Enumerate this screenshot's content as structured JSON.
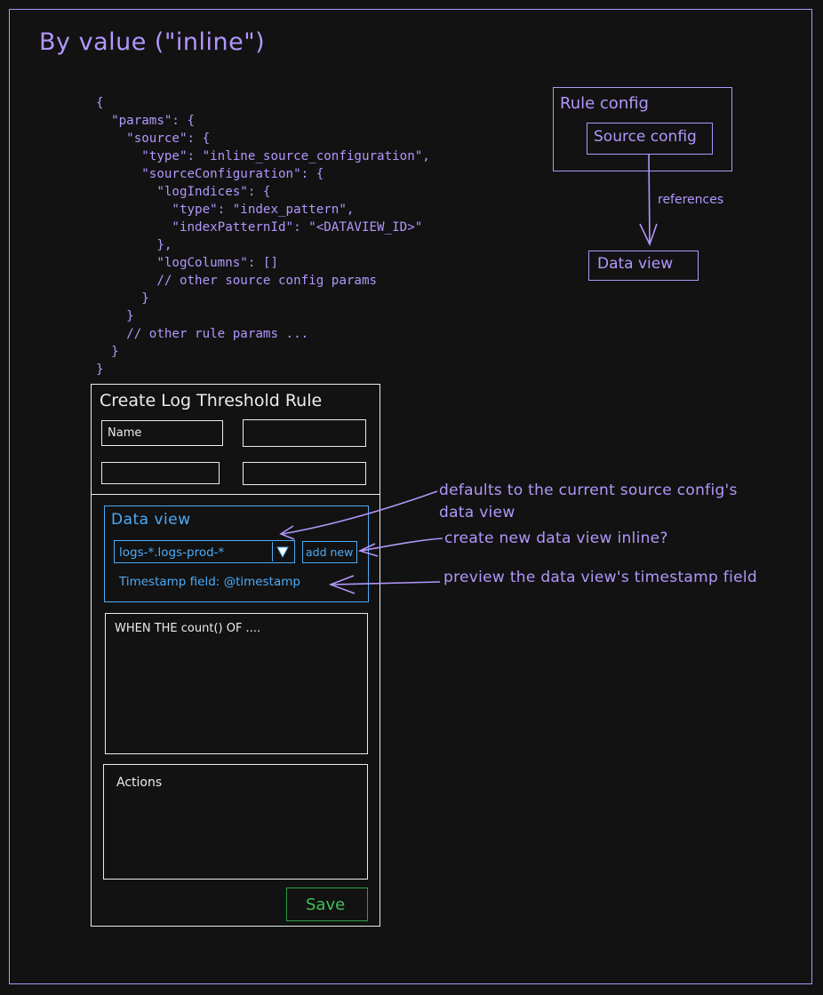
{
  "title": "By value (\"inline\")",
  "code_lines": [
    "{",
    "  \"params\": {",
    "    \"source\": {",
    "      \"type\": \"inline_source_configuration\",",
    "      \"sourceConfiguration\": {",
    "        \"logIndices\": {",
    "          \"type\": \"index_pattern\",",
    "          \"indexPatternId\": \"<DATAVIEW_ID>\"",
    "        },",
    "        \"logColumns\": []",
    "        // other source config params",
    "      }",
    "    }",
    "    // other rule params ...",
    "  }",
    "}"
  ],
  "diagram": {
    "rule_config": "Rule config",
    "source_config": "Source config",
    "references": "references",
    "data_view": "Data view"
  },
  "form": {
    "title": "Create Log Threshold Rule",
    "name_placeholder": "Name",
    "data_view_section": {
      "title": "Data view",
      "selected": "logs-*.logs-prod-*",
      "add_new": "add new",
      "timestamp": "Timestamp field: @timestamp"
    },
    "condition": "WHEN THE count() OF ....",
    "actions": "Actions",
    "save": "Save"
  },
  "annotations": {
    "defaults_line1": "defaults to the current source config's",
    "defaults_line2": "data view",
    "create_new": "create new data view inline?",
    "preview": "preview the data view's timestamp field"
  },
  "colors": {
    "background": "#121212",
    "accent": "#b197fc",
    "form": "#e9ecef",
    "data_view": "#4dabf7",
    "save": "#40c057"
  }
}
